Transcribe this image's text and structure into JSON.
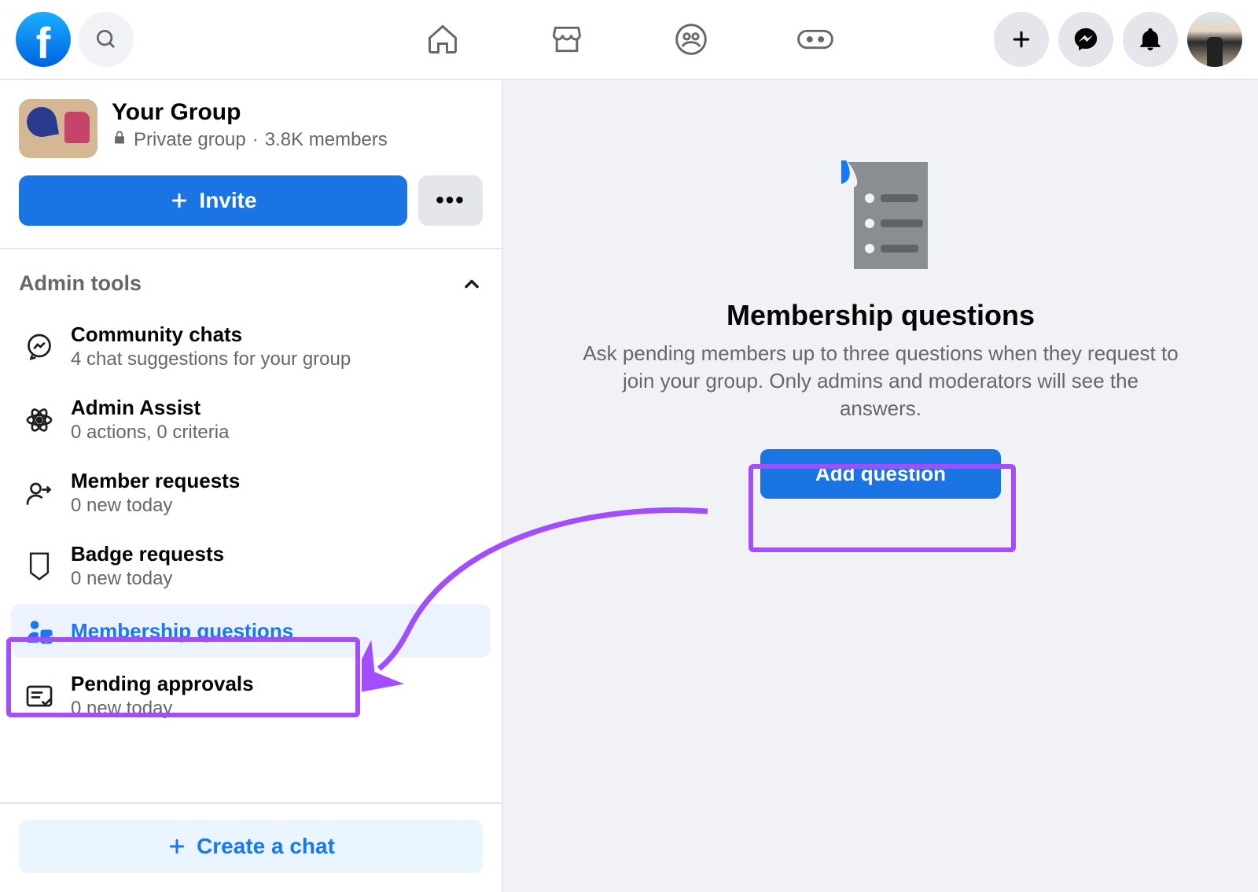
{
  "topbar": {
    "logo_letter": "f"
  },
  "group": {
    "name": "Your Group",
    "privacy": "Private group",
    "member_count": "3.8K members",
    "invite_label": "Invite"
  },
  "sections": {
    "admin_tools_label": "Admin tools"
  },
  "sidebar_items": {
    "community_chats": {
      "label": "Community chats",
      "sub": "4 chat suggestions for your group"
    },
    "admin_assist": {
      "label": "Admin Assist",
      "sub": "0 actions, 0 criteria"
    },
    "member_requests": {
      "label": "Member requests",
      "sub": "0 new today"
    },
    "badge_requests": {
      "label": "Badge requests",
      "sub": "0 new today"
    },
    "membership_questions": {
      "label": "Membership questions"
    },
    "pending_approvals": {
      "label": "Pending approvals",
      "sub": "0 new today"
    }
  },
  "create_chat_label": "Create a chat",
  "main": {
    "title": "Membership questions",
    "description": "Ask pending members up to three questions when they request to join your group. Only admins and moderators will see the answers.",
    "add_question_label": "Add question"
  }
}
